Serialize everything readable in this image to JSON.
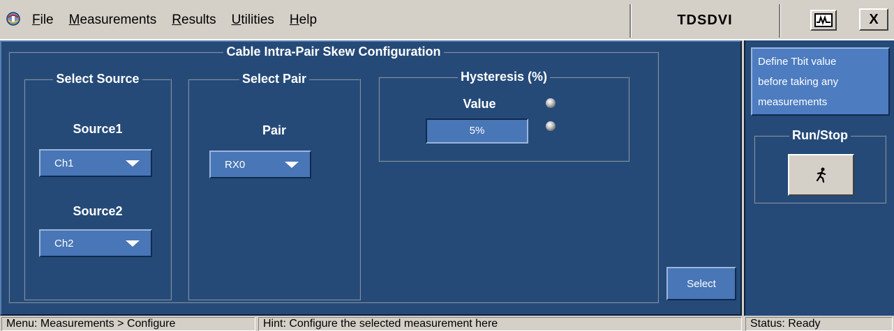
{
  "menu": {
    "items": [
      {
        "label": "File",
        "mnemonic": "F",
        "rest": "ile"
      },
      {
        "label": "Measurements",
        "mnemonic": "M",
        "rest": "easurements"
      },
      {
        "label": "Results",
        "mnemonic": "R",
        "rest": "esults"
      },
      {
        "label": "Utilities",
        "mnemonic": "U",
        "rest": "tilities"
      },
      {
        "label": "Help",
        "mnemonic": "H",
        "rest": "elp"
      }
    ],
    "app_title": "TDSDVI",
    "close_label": "X"
  },
  "config": {
    "title": "Cable Intra-Pair Skew Configuration",
    "select_source": {
      "title": "Select Source",
      "source1_label": "Source1",
      "source1_value": "Ch1",
      "source2_label": "Source2",
      "source2_value": "Ch2"
    },
    "select_pair": {
      "title": "Select Pair",
      "pair_label": "Pair",
      "pair_value": "RX0"
    },
    "hysteresis": {
      "title": "Hysteresis (%)",
      "value_label": "Value",
      "value": "5%"
    },
    "select_button": "Select"
  },
  "side": {
    "notice_lines": [
      "Define Tbit value",
      "before taking any",
      "measurements"
    ],
    "run_stop_title": "Run/Stop"
  },
  "status": {
    "menu_path": "Menu: Measurements > Configure",
    "hint": "Hint: Configure the selected measurement here",
    "status": "Status: Ready"
  },
  "colors": {
    "panel_bg": "#254a78",
    "control_bg": "#4876b6",
    "chrome": "#d4d0c8"
  },
  "icons": [
    "app-icon",
    "scope-icon",
    "close-icon",
    "dropdown-arrow-icon",
    "knob-icon",
    "run-figure-icon"
  ]
}
